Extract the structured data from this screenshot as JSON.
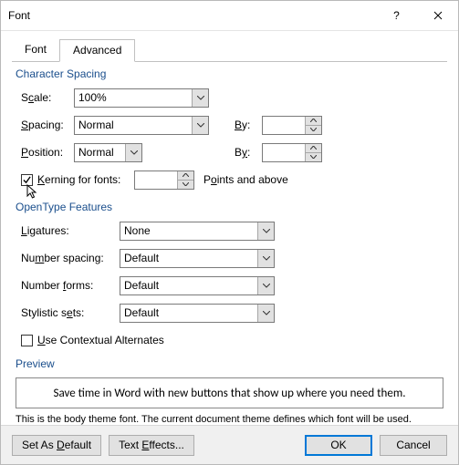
{
  "title": "Font",
  "tabs": {
    "font": "Font",
    "advanced": "Advanced"
  },
  "char_spacing": {
    "legend": "Character Spacing",
    "scale_label": "Scale:",
    "scale_value": "100%",
    "spacing_label": "Spacing:",
    "spacing_value": "Normal",
    "by1_label": "By:",
    "by1_value": "",
    "position_label": "Position:",
    "position_value": "Normal",
    "by2_label": "By:",
    "by2_value": "",
    "kerning_checked": true,
    "kerning_label": "Kerning for fonts:",
    "kerning_value": "",
    "kerning_suffix": "Points and above"
  },
  "opentype": {
    "legend": "OpenType Features",
    "ligatures_label": "Ligatures:",
    "ligatures_value": "None",
    "numspacing_label": "Number spacing:",
    "numspacing_value": "Default",
    "numforms_label": "Number forms:",
    "numforms_value": "Default",
    "stylistic_label": "Stylistic sets:",
    "stylistic_value": "Default",
    "contextual_checked": false,
    "contextual_label": "Use Contextual Alternates"
  },
  "preview": {
    "legend": "Preview",
    "sample": "Save time in Word with new buttons that show up where you need them.",
    "note": "This is the body theme font. The current document theme defines which font will be used."
  },
  "footer": {
    "set_default": "Set As Default",
    "text_effects": "Text Effects...",
    "ok": "OK",
    "cancel": "Cancel"
  }
}
